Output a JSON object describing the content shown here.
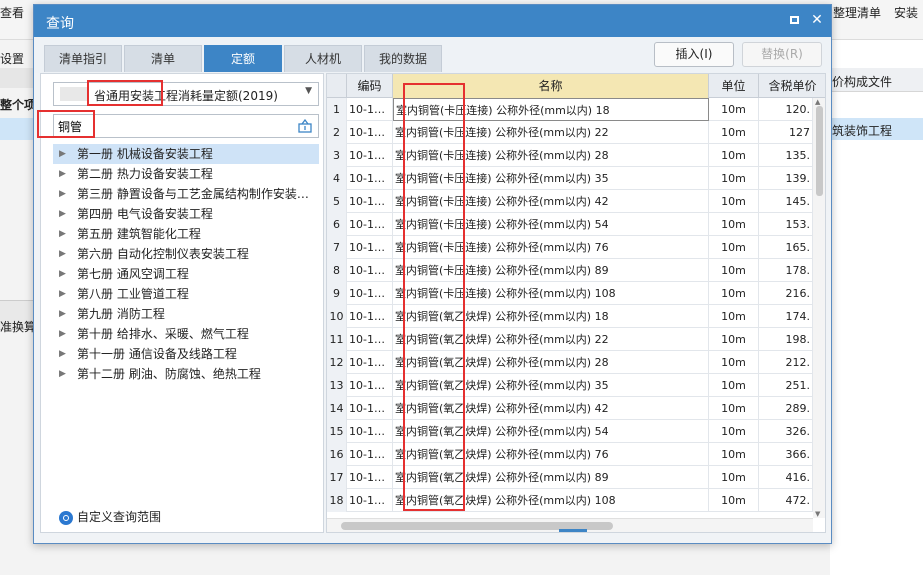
{
  "background": {
    "menu_view": "查看",
    "menu_organize": "整理清单",
    "menu_install": "安装",
    "left_settings": "设置",
    "left_whole": "整个项",
    "left_convert": "准换算",
    "right_header": "价构成文件",
    "right_row": "筑装饰工程"
  },
  "dialog": {
    "title": "查询",
    "tabs": [
      "清单指引",
      "清单",
      "定额",
      "人材机",
      "我的数据"
    ],
    "active_tab": "定额",
    "insert_button": "插入(I)",
    "replace_button": "替换(R)"
  },
  "left": {
    "quota_library": "省通用安装工程消耗量定额(2019)",
    "search_value": "铜管",
    "tree": [
      "第一册 机械设备安装工程",
      "第二册 热力设备安装工程",
      "第三册 静置设备与工艺金属结构制作安装…",
      "第四册 电气设备安装工程",
      "第五册 建筑智能化工程",
      "第六册 自动化控制仪表安装工程",
      "第七册 通风空调工程",
      "第八册 工业管道工程",
      "第九册 消防工程",
      "第十册 给排水、采暖、燃气工程",
      "第十一册 通信设备及线路工程",
      "第十二册 刷油、防腐蚀、绝热工程"
    ],
    "custom_range": "自定义查询范围"
  },
  "grid": {
    "headers": {
      "code": "编码",
      "name": "名称",
      "unit": "单位",
      "price": "含税单价"
    },
    "rows": [
      {
        "idx": "1",
        "code": "10-1…",
        "name": "室内铜管(卡压连接) 公称外径(mm以内) 18",
        "unit": "10m",
        "price": "120."
      },
      {
        "idx": "2",
        "code": "10-1…",
        "name": "室内铜管(卡压连接) 公称外径(mm以内) 22",
        "unit": "10m",
        "price": "127"
      },
      {
        "idx": "3",
        "code": "10-1…",
        "name": "室内铜管(卡压连接) 公称外径(mm以内) 28",
        "unit": "10m",
        "price": "135."
      },
      {
        "idx": "4",
        "code": "10-1…",
        "name": "室内铜管(卡压连接) 公称外径(mm以内) 35",
        "unit": "10m",
        "price": "139."
      },
      {
        "idx": "5",
        "code": "10-1…",
        "name": "室内铜管(卡压连接) 公称外径(mm以内) 42",
        "unit": "10m",
        "price": "145."
      },
      {
        "idx": "6",
        "code": "10-1…",
        "name": "室内铜管(卡压连接) 公称外径(mm以内) 54",
        "unit": "10m",
        "price": "153."
      },
      {
        "idx": "7",
        "code": "10-1…",
        "name": "室内铜管(卡压连接) 公称外径(mm以内) 76",
        "unit": "10m",
        "price": "165."
      },
      {
        "idx": "8",
        "code": "10-1…",
        "name": "室内铜管(卡压连接) 公称外径(mm以内) 89",
        "unit": "10m",
        "price": "178."
      },
      {
        "idx": "9",
        "code": "10-1…",
        "name": "室内铜管(卡压连接) 公称外径(mm以内) 108",
        "unit": "10m",
        "price": "216."
      },
      {
        "idx": "10",
        "code": "10-1…",
        "name": "室内铜管(氧乙炔焊) 公称外径(mm以内) 18",
        "unit": "10m",
        "price": "174."
      },
      {
        "idx": "11",
        "code": "10-1…",
        "name": "室内铜管(氧乙炔焊) 公称外径(mm以内) 22",
        "unit": "10m",
        "price": "198."
      },
      {
        "idx": "12",
        "code": "10-1…",
        "name": "室内铜管(氧乙炔焊) 公称外径(mm以内) 28",
        "unit": "10m",
        "price": "212."
      },
      {
        "idx": "13",
        "code": "10-1…",
        "name": "室内铜管(氧乙炔焊) 公称外径(mm以内) 35",
        "unit": "10m",
        "price": "251."
      },
      {
        "idx": "14",
        "code": "10-1…",
        "name": "室内铜管(氧乙炔焊) 公称外径(mm以内) 42",
        "unit": "10m",
        "price": "289."
      },
      {
        "idx": "15",
        "code": "10-1…",
        "name": "室内铜管(氧乙炔焊) 公称外径(mm以内) 54",
        "unit": "10m",
        "price": "326."
      },
      {
        "idx": "16",
        "code": "10-1…",
        "name": "室内铜管(氧乙炔焊) 公称外径(mm以内) 76",
        "unit": "10m",
        "price": "366."
      },
      {
        "idx": "17",
        "code": "10-1…",
        "name": "室内铜管(氧乙炔焊) 公称外径(mm以内) 89",
        "unit": "10m",
        "price": "416."
      },
      {
        "idx": "18",
        "code": "10-1…",
        "name": "室内铜管(氧乙炔焊) 公称外径(mm以内) 108",
        "unit": "10m",
        "price": "472."
      }
    ]
  },
  "colors": {
    "accent": "#3d85c6",
    "highlight_box": "#e53030",
    "name_header": "#f4e7b3"
  }
}
